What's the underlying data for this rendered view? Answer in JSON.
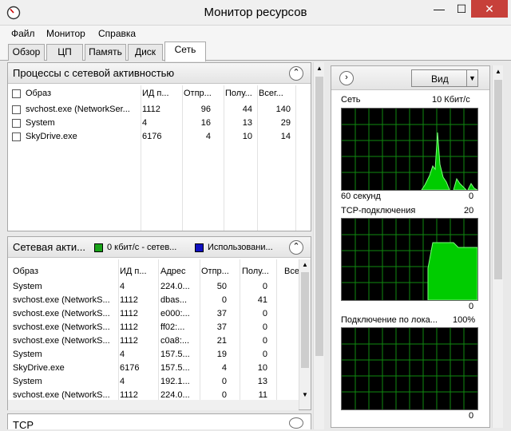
{
  "window": {
    "title": "Монитор ресурсов",
    "minimize": "—",
    "maximize": "☐",
    "close": "✕"
  },
  "menu": [
    "Файл",
    "Монитор",
    "Справка"
  ],
  "tabs": [
    "Обзор",
    "ЦП",
    "Память",
    "Диск",
    "Сеть"
  ],
  "processes": {
    "title": "Процессы с сетевой активностью",
    "columns": [
      "Образ",
      "ИД п...",
      "Отпр...",
      "Полу...",
      "Всег..."
    ],
    "rows": [
      [
        "svchost.exe (NetworkSer...",
        "1112",
        "96",
        "44",
        "140"
      ],
      [
        "System",
        "4",
        "16",
        "13",
        "29"
      ],
      [
        "SkyDrive.exe",
        "6176",
        "4",
        "10",
        "14"
      ]
    ]
  },
  "network_activity": {
    "title": "Сетевая акти...",
    "indicator1": "0 кбит/с - сетев...",
    "indicator2": "Использовани...",
    "indicator1_color": "#1aa31a",
    "indicator2_color": "#1010c0",
    "columns": [
      "Образ",
      "ИД п...",
      "Адрес",
      "Отпр...",
      "Полу...",
      "Всег"
    ],
    "rows": [
      [
        "System",
        "4",
        "224.0...",
        "50",
        "0"
      ],
      [
        "svchost.exe (NetworkS...",
        "1112",
        "dbas...",
        "0",
        "41"
      ],
      [
        "svchost.exe (NetworkS...",
        "1112",
        "e000:...",
        "37",
        "0"
      ],
      [
        "svchost.exe (NetworkS...",
        "1112",
        "ff02:...",
        "37",
        "0"
      ],
      [
        "svchost.exe (NetworkS...",
        "1112",
        "c0a8:...",
        "21",
        "0"
      ],
      [
        "System",
        "4",
        "157.5...",
        "19",
        "0"
      ],
      [
        "SkyDrive.exe",
        "6176",
        "157.5...",
        "4",
        "10"
      ],
      [
        "System",
        "4",
        "192.1...",
        "0",
        "13"
      ],
      [
        "svchost.exe (NetworkS...",
        "1112",
        "224.0...",
        "0",
        "11"
      ]
    ]
  },
  "tcp_section_title": "TCP",
  "right": {
    "view_label": "Вид",
    "graphs": [
      {
        "title": "Сеть",
        "scale": "10 Кбит/с",
        "bottom_left": "60 секунд",
        "bottom_right": "0"
      },
      {
        "title": "TCP-подключения",
        "scale": "20",
        "bottom_left": "",
        "bottom_right": "0"
      },
      {
        "title": "Подключение по лока...",
        "scale": "100%",
        "bottom_left": "",
        "bottom_right": "0"
      }
    ]
  }
}
